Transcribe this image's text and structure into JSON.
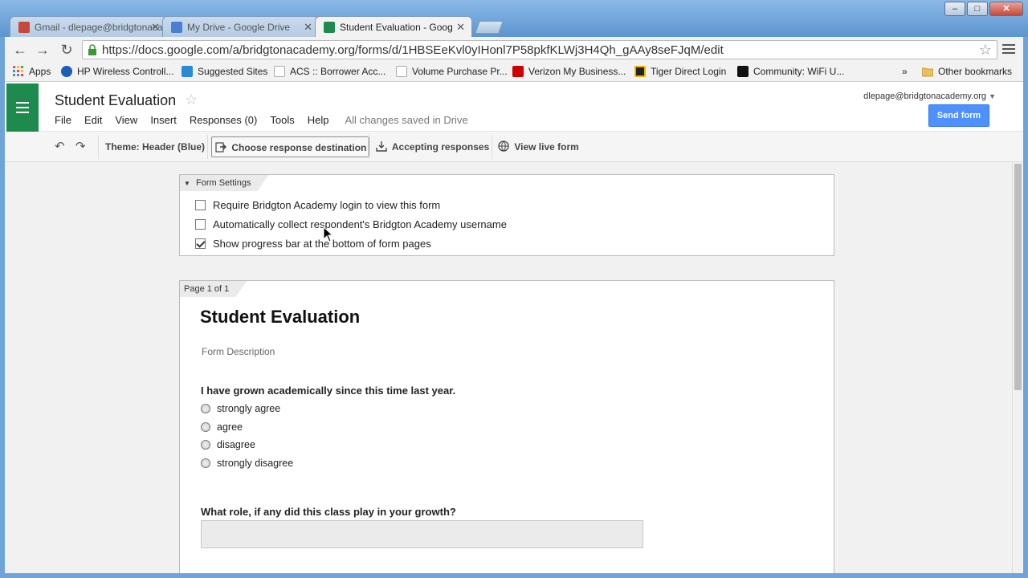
{
  "browser": {
    "tabs": [
      {
        "label": "Gmail - dlepage@bridgtonacademy.org",
        "favicon_color": "#c5483a",
        "active": false
      },
      {
        "label": "My Drive - Google Drive",
        "favicon_color": "#4a7fd1",
        "active": false
      },
      {
        "label": "Student Evaluation - Goog",
        "favicon_color": "#1e8a4e",
        "active": true
      }
    ],
    "url": "https://docs.google.com/a/bridgtonacademy.org/forms/d/1HBSEeKvl0yIHonl7P58pkfKLWj3H4Qh_gAAy8seFJqM/edit",
    "bookmarks": [
      {
        "label": "Apps",
        "icon": "apps-grid-icon",
        "color": "#e44"
      },
      {
        "label": "HP Wireless Controll...",
        "icon": "hp-icon",
        "color": "#1a5fb4"
      },
      {
        "label": "Suggested Sites",
        "icon": "suggested-sites-icon",
        "color": "#2a8ad4"
      },
      {
        "label": "ACS :: Borrower Acc...",
        "icon": "page-icon",
        "color": "#ffffff"
      },
      {
        "label": "Volume Purchase Pr...",
        "icon": "page-icon",
        "color": "#ffffff"
      },
      {
        "label": "Verizon My Business...",
        "icon": "verizon-icon",
        "color": "#cc0000"
      },
      {
        "label": "Tiger Direct Login",
        "icon": "tiger-direct-icon",
        "color": "#222222"
      },
      {
        "label": "Community: WiFi U...",
        "icon": "info-icon",
        "color": "#111111"
      }
    ],
    "bookmarks_overflow": "»",
    "other_bookmarks": "Other bookmarks"
  },
  "docs": {
    "title": "Student Evaluation",
    "menu": [
      "File",
      "Edit",
      "View",
      "Insert",
      "Responses (0)",
      "Tools",
      "Help"
    ],
    "save_status": "All changes saved in Drive",
    "account": "dlepage@bridgtonacademy.org",
    "send_button": "Send form"
  },
  "edit_toolbar": {
    "theme": "Theme: Header (Blue)",
    "choose_destination": "Choose response destination",
    "accepting": "Accepting responses",
    "view_live": "View live form"
  },
  "form_settings": {
    "tag": "Form Settings",
    "options": [
      {
        "label": "Require Bridgton Academy login to view this form",
        "checked": false
      },
      {
        "label": "Automatically collect respondent's Bridgton Academy username",
        "checked": false
      },
      {
        "label": "Show progress bar at the bottom of form pages",
        "checked": true
      }
    ]
  },
  "page": {
    "tag": "Page 1 of 1",
    "form_title": "Student Evaluation",
    "form_description": "Form Description",
    "questions": [
      {
        "title": "I have grown academically since this time last year.",
        "type": "multiple-choice",
        "options": [
          "strongly agree",
          "agree",
          "disagree",
          "strongly disagree"
        ]
      },
      {
        "title": "What role, if any did this class play in your growth?",
        "type": "text"
      }
    ]
  }
}
